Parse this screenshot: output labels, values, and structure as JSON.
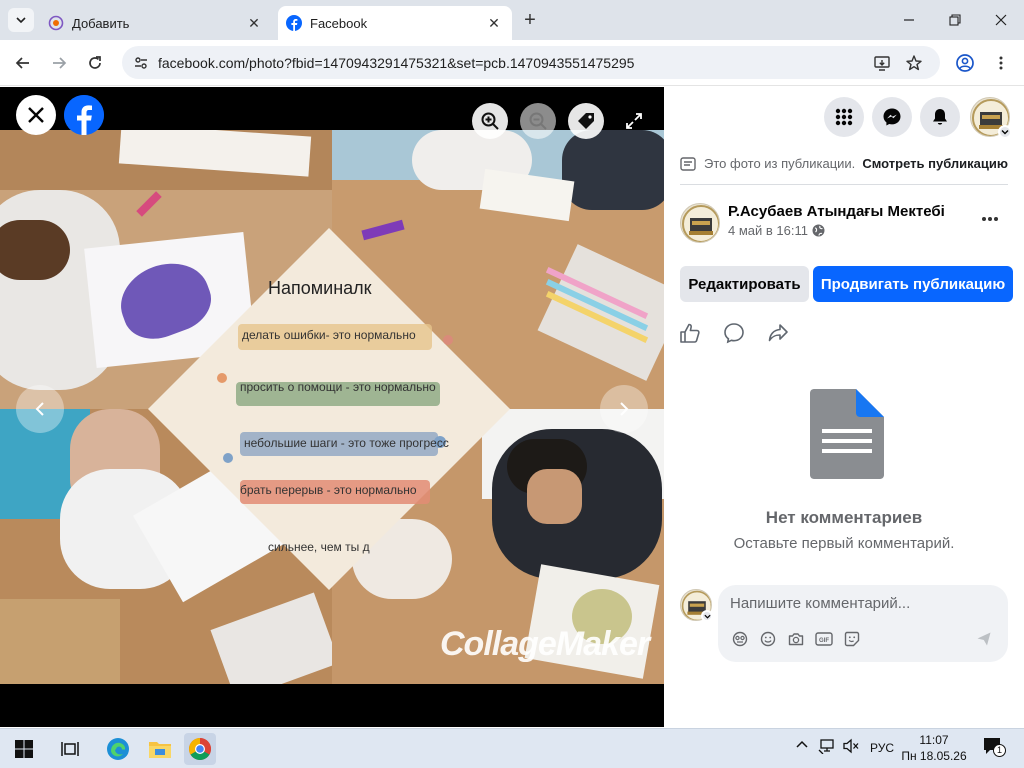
{
  "browser": {
    "tabs": [
      {
        "title": "Добавить",
        "active": false
      },
      {
        "title": "Facebook",
        "active": true
      }
    ],
    "url": "facebook.com/photo?fbid=1470943291475321&set=pcb.1470943551475295"
  },
  "viewer": {
    "poster": {
      "title": "Напоминалк",
      "lines": [
        "делать ошибки- это нормально",
        "просить о помощи - это нормально",
        "небольшие шаги - это тоже прогресс",
        "брать перерыв - это нормально",
        "сильнее, чем ты д"
      ]
    },
    "watermark": "CollageMaker"
  },
  "panel": {
    "publication_note": "Это фото из публикации.",
    "view_publication": "Смотреть публикацию",
    "author": "Р.Асубаев Атындағы Мектебі",
    "date": "4 май в 16:11",
    "edit_button": "Редактировать",
    "promote_button": "Продвигать публикацию",
    "no_comments_title": "Нет комментариев",
    "no_comments_sub": "Оставьте первый комментарий.",
    "comment_placeholder": "Напишите комментарий..."
  },
  "taskbar": {
    "language": "РУС",
    "time": "11:07",
    "date": "Пн 18.05.26",
    "notifications": "1"
  },
  "colors": {
    "facebook_blue": "#0866ff",
    "tabstrip": "#dee3ea",
    "taskbar": "#dfe7f2",
    "poster_bg": "#f3eadc"
  }
}
